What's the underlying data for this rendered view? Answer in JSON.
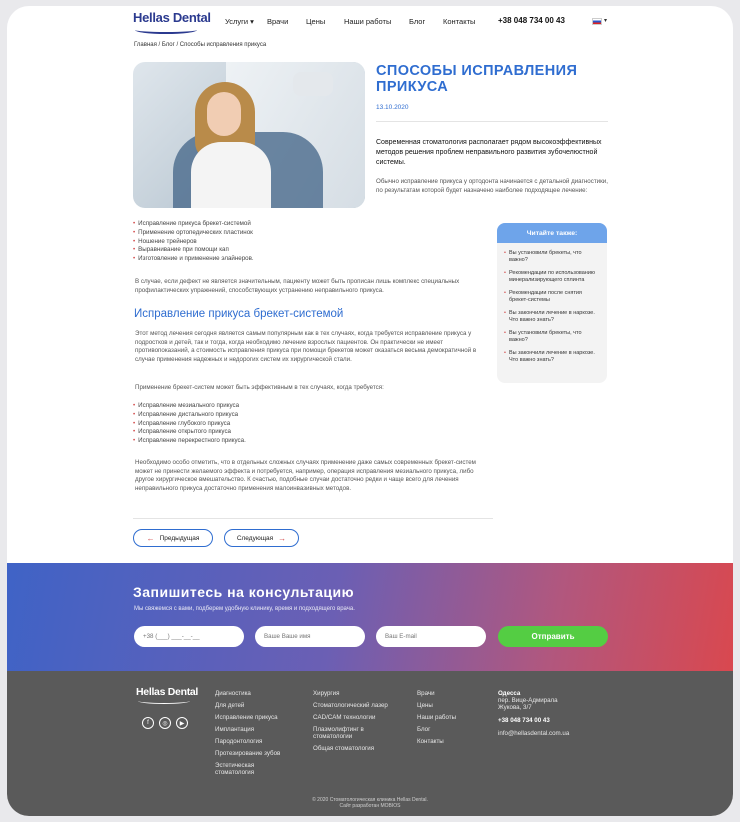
{
  "header": {
    "logo": "Hellas Dental",
    "nav": [
      {
        "label": "Услуги ▾"
      },
      {
        "label": "Врачи"
      },
      {
        "label": "Цены"
      },
      {
        "label": "Наши работы"
      },
      {
        "label": "Блог"
      },
      {
        "label": "Контакты"
      }
    ],
    "phone": "+38 048 734 00 43",
    "language_caret": "▾"
  },
  "breadcrumb": "Главная  /  Блог  /  Способы исправления прикуса",
  "article": {
    "title": "СПОСОБЫ ИСПРАВЛЕНИЯ ПРИКУСА",
    "date": "13.10.2020",
    "lead": "Современная стоматология располагает рядом высокоэффективных методов решения проблем неправильного развития зубочелюстной системы.",
    "intro": "Обычно исправление прикуса у ортодонта начинается с детальной диагностики, по результатам которой будет назначено наиболее подходящее лечение:",
    "methods": [
      "Исправление прикуса брекет-системой",
      "Применение ортопедических пластинок",
      "Ношение трейнеров",
      "Выравнивание при помощи кап",
      "Изготовление и применение элайнеров."
    ],
    "para1": "В случае, если дефект не является значительным, пациенту может быть прописан лишь комплекс специальных профилактических упражнений, способствующих устранению неправильного прикуса.",
    "section_title": "Исправление прикуса брекет-системой",
    "para2": "Этот метод лечения сегодня является самым популярным как в тех случаях, когда требуется исправление прикуса у подростков и детей, так и тогда, когда необходимо лечение взрослых пациентов. Он практически не имеет противопоказаний, а стоимость исправления прикуса при помощи брекетов может оказаться весьма демократичной в случае применения надежных и недорогих систем их хирургической стали.",
    "para3": "Применение брекет-систем может быть эффективным в тех случаях, когда требуется:",
    "cases": [
      "Исправление мезиального прикуса",
      "Исправление дистального прикуса",
      "Исправление глубокого прикуса",
      "Исправление открытого прикуса",
      "Исправление перекрестного прикуса."
    ],
    "para4": "Необходимо особо отметить, что в отдельных сложных случаях применение даже самых современных брекет-систем может не принести желаемого эффекта и потребуется, например, операция исправления мезиального прикуса, либо другое хирургическое вмешательство. К счастью, подобные случаи достаточно редки и чаще всего для лечения неправильного прикуса достаточно применения малоинвазивных методов.",
    "prev": "Предыдущая",
    "next": "Следующая"
  },
  "sidebar": {
    "title": "Читайте также:",
    "items": [
      "Вы установили брекеты, что важно?",
      "Рекомендации по использованию минерализирующего сплинта",
      "Рекомендации после снятия брекет-системы",
      "Вы закончили лечение в наркозе. Что важно знать?",
      "Вы установили брекеты, что важно?",
      "Вы закончили лечение в наркозе. Что важно знать?"
    ]
  },
  "consult": {
    "title": "Запишитесь на консультацию",
    "subtitle": "Мы свяжемся с вами, подберем удобную клинику, время и подходящего врача.",
    "phone_placeholder": "+38 (___) ___-__-__",
    "name_placeholder": "Ваше Ваше имя",
    "email_placeholder": "Ваш E-mail",
    "submit": "Отправить"
  },
  "footer": {
    "logo": "Hellas Dental",
    "social": [
      "f",
      "◎",
      "▶"
    ],
    "col1": [
      "Диагностика",
      "Для детей",
      "Исправление прикуса",
      "Имплантация",
      "Пародонтология",
      "Протезирование зубов",
      "Эстетическая стоматология"
    ],
    "col2": [
      "Хирургия",
      "Стоматологический лазер",
      "CAD/CAM технологии",
      "Плазмолифтинг в стоматологии",
      "Общая стоматология"
    ],
    "col3": [
      "Врачи",
      "Цены",
      "Наши работы",
      "Блог",
      "Контакты"
    ],
    "city": "Одесса",
    "address": "пер. Вице-Адмирала Жукова, 3/7",
    "phone": "+38 048 734 00 43",
    "email": "info@hellasdental.com.ua",
    "copyright": "© 2020 Стоматологическая клиника Hellas Dental.",
    "developer": "Сайт разработан MOBIOS"
  },
  "colors": {
    "accent": "#2f6dd0",
    "bullet": "#d24a4a",
    "submit": "#54cd43",
    "footer": "#5a5a5a"
  }
}
